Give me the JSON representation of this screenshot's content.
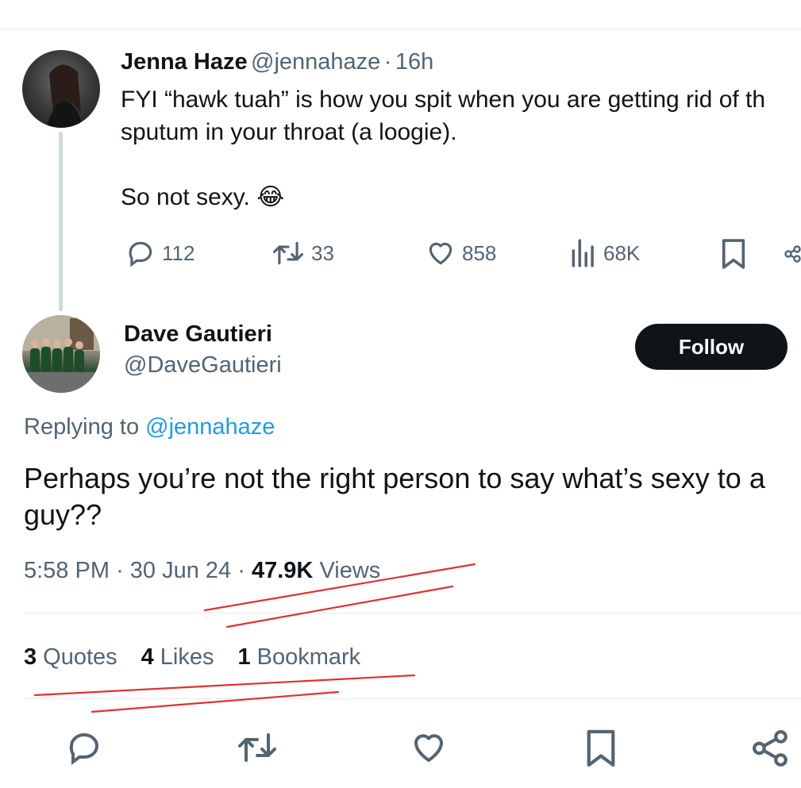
{
  "parent_tweet": {
    "author_name": "Jenna Haze",
    "author_handle": "@jennahaze",
    "separator": "·",
    "time_ago": "16h",
    "text_line1": "FYI “hawk tuah” is how you spit when you are getting rid of th",
    "text_line2": "sputum in your throat (a loogie).",
    "text_line3": "So not sexy. 😂",
    "actions": {
      "replies": "112",
      "reposts": "33",
      "likes": "858",
      "views": "68K"
    }
  },
  "reply_tweet": {
    "author_name": "Dave Gautieri",
    "author_handle": "@DaveGautieri",
    "follow_label": "Follow",
    "replying_prefix": "Replying to",
    "replying_handle": "@jennahaze",
    "text_line1": "Perhaps you’re not the right person to say what’s sexy to a",
    "text_line2": "guy??",
    "time": "5:58 PM",
    "date": "30 Jun 24",
    "views_count": "47.9K",
    "views_label": "Views",
    "stats": {
      "quotes_count": "3",
      "quotes_label": "Quotes",
      "likes_count": "4",
      "likes_label": "Likes",
      "bookmarks_count": "1",
      "bookmarks_label": "Bookmark"
    }
  },
  "icons": {
    "reply": "reply-icon",
    "repost": "repost-icon",
    "like": "heart-icon",
    "views": "views-icon",
    "bookmark": "bookmark-icon",
    "share": "share-icon"
  },
  "colors": {
    "text": "#0f1419",
    "secondary": "#536471",
    "link": "#1d9bf0",
    "button_bg": "#0f1419",
    "annotation": "#e03131"
  }
}
